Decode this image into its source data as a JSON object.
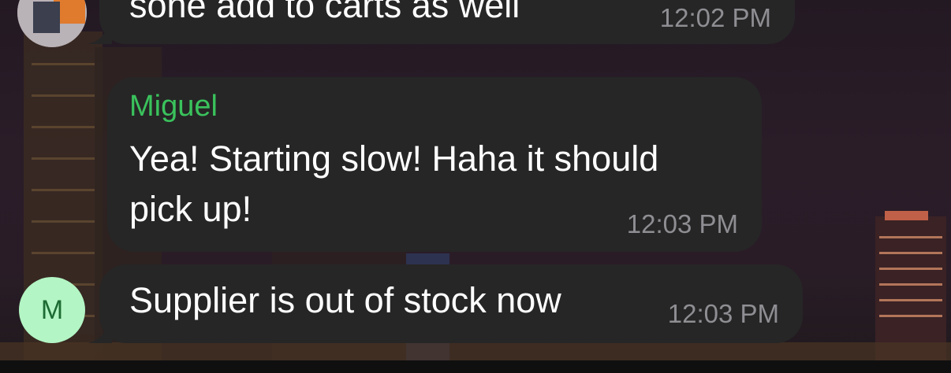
{
  "messages": [
    {
      "text": "sone add to carts as well",
      "time": "12:02 PM"
    },
    {
      "sender": "Miguel",
      "text_lines": [
        "Yea! Starting slow! Haha it should",
        "pick up!"
      ],
      "time": "12:03 PM"
    },
    {
      "text": "Supplier is out of stock now",
      "time": "12:03 PM"
    }
  ],
  "avatar_initial": "M",
  "colors": {
    "bubble": "#262626",
    "sender_name": "#3ac25c",
    "timestamp": "#8e8e93",
    "avatar_bg": "#b3f5c4",
    "avatar_text": "#1d6b34"
  }
}
